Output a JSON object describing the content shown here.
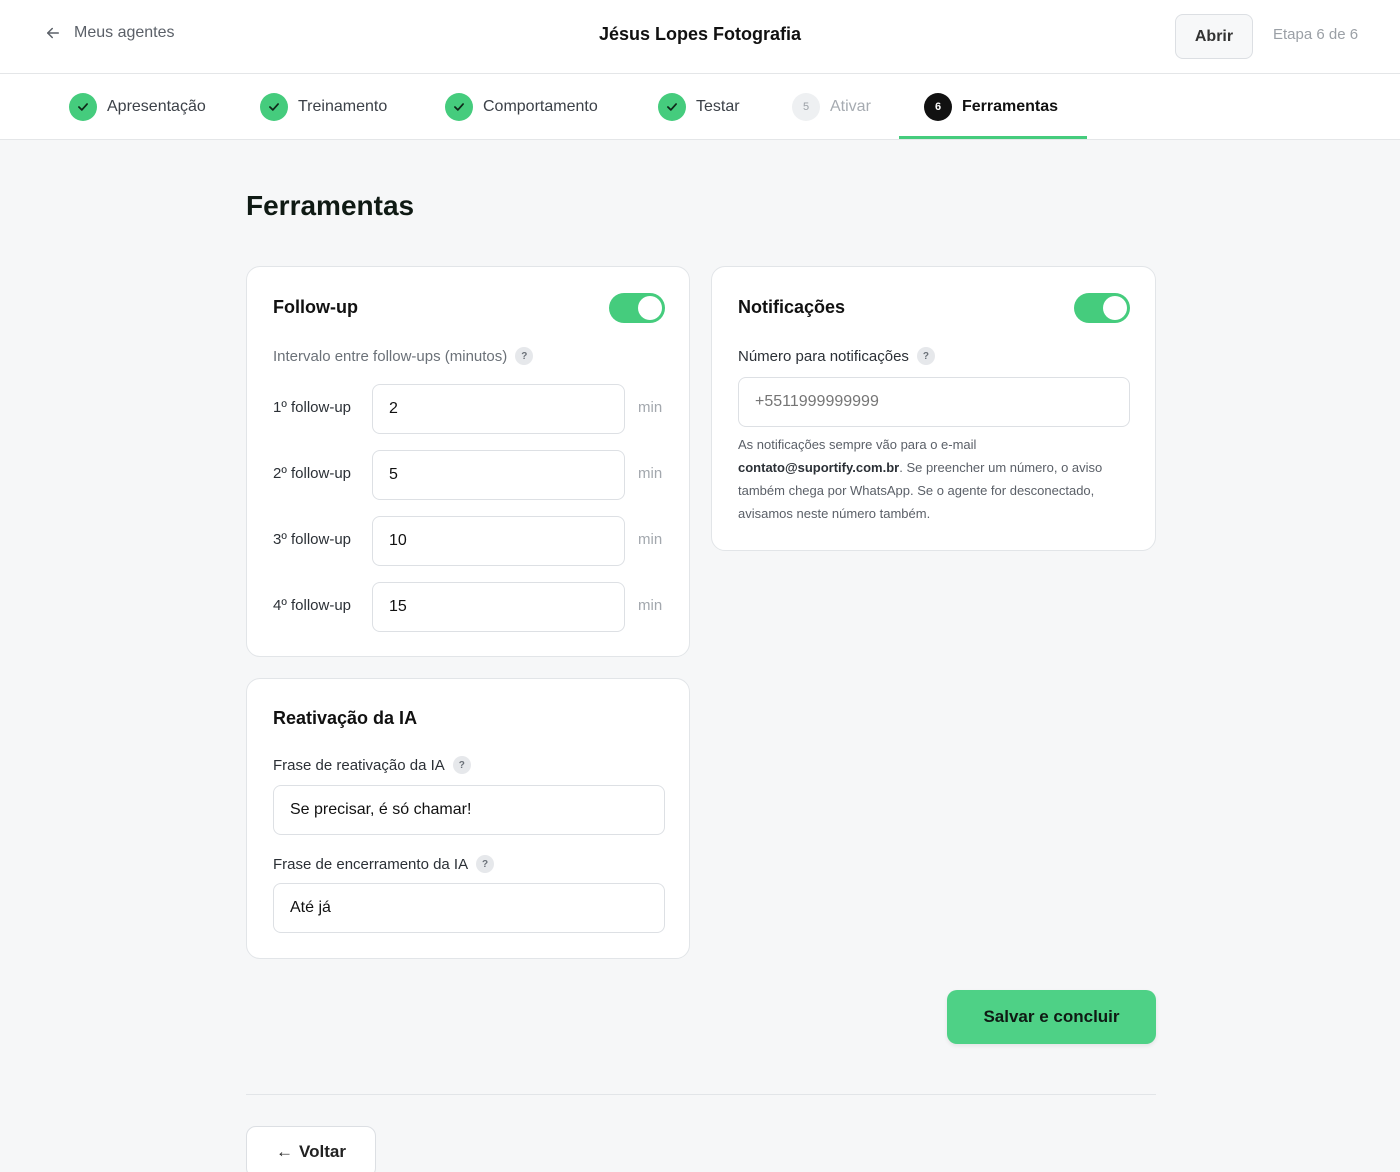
{
  "header": {
    "back_label": "Meus agentes",
    "agent_name": "Jésus Lopes Fotografia",
    "open_label": "Abrir",
    "step_counter": "Etapa 6 de 6"
  },
  "steps": [
    {
      "label": "Apresentação",
      "status": "done"
    },
    {
      "label": "Treinamento",
      "status": "done"
    },
    {
      "label": "Comportamento",
      "status": "done"
    },
    {
      "label": "Testar",
      "status": "done"
    },
    {
      "label": "Ativar",
      "status": "pending",
      "number": "5"
    },
    {
      "label": "Ferramentas",
      "status": "current",
      "number": "6"
    }
  ],
  "page": {
    "title": "Ferramentas"
  },
  "followup": {
    "title": "Follow-up",
    "enabled": true,
    "interval_label": "Intervalo entre follow-ups (minutos)",
    "rows": [
      {
        "label": "1º follow-up",
        "value": "2",
        "unit": "min"
      },
      {
        "label": "2º follow-up",
        "value": "5",
        "unit": "min"
      },
      {
        "label": "3º follow-up",
        "value": "10",
        "unit": "min"
      },
      {
        "label": "4º follow-up",
        "value": "15",
        "unit": "min"
      }
    ]
  },
  "notifications": {
    "title": "Notificações",
    "enabled": true,
    "number_label": "Número para notificações",
    "number_placeholder": "+5511999999999",
    "note_prefix": "As notificações sempre vão para o e-mail",
    "note_email": "contato@suportify.com.br",
    "note_suffix": ". Se preencher um número, o aviso também chega por WhatsApp. Se o agente for desconectado, avisamos neste número também."
  },
  "reactivation": {
    "title": "Reativação da IA",
    "reactivation_label": "Frase de reativação da IA",
    "reactivation_value": "Se precisar, é só chamar!",
    "closing_label": "Frase de encerramento da IA",
    "closing_value": "Até já"
  },
  "help_glyph": "?",
  "actions": {
    "save_label": "Salvar e concluir",
    "back_label": "Voltar",
    "back_arrow": "←"
  },
  "colors": {
    "accent": "#45cc7d",
    "button_green": "#4ed186"
  }
}
